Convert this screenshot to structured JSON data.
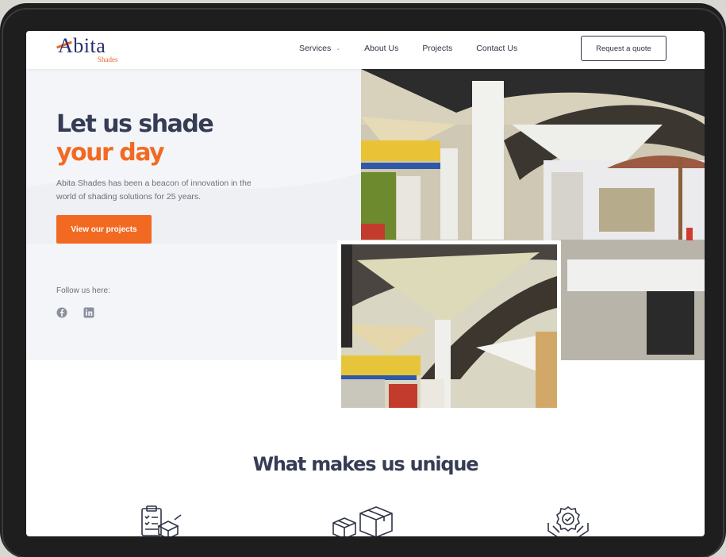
{
  "brand": {
    "name": "Abita",
    "tagline": "Shades"
  },
  "nav": {
    "links": [
      {
        "label": "Services",
        "dropdown": true
      },
      {
        "label": "About Us"
      },
      {
        "label": "Projects"
      },
      {
        "label": "Contact Us"
      }
    ],
    "cta_label": "Request a quote"
  },
  "hero": {
    "title_line1": "Let us shade",
    "title_line2": "your day",
    "description": "Abita Shades has been a beacon of innovation in the world of shading solutions for 25 years.",
    "button_label": "View our projects",
    "follow_label": "Follow us here:",
    "socials": [
      "facebook-icon",
      "linkedin-icon"
    ]
  },
  "unique": {
    "title": "What makes us unique",
    "features": [
      "clipboard-box-icon",
      "boxes-icon",
      "award-hands-icon"
    ]
  },
  "colors": {
    "accent": "#f26a21",
    "heading": "#353c54",
    "brand_blue": "#2a2f6e"
  }
}
